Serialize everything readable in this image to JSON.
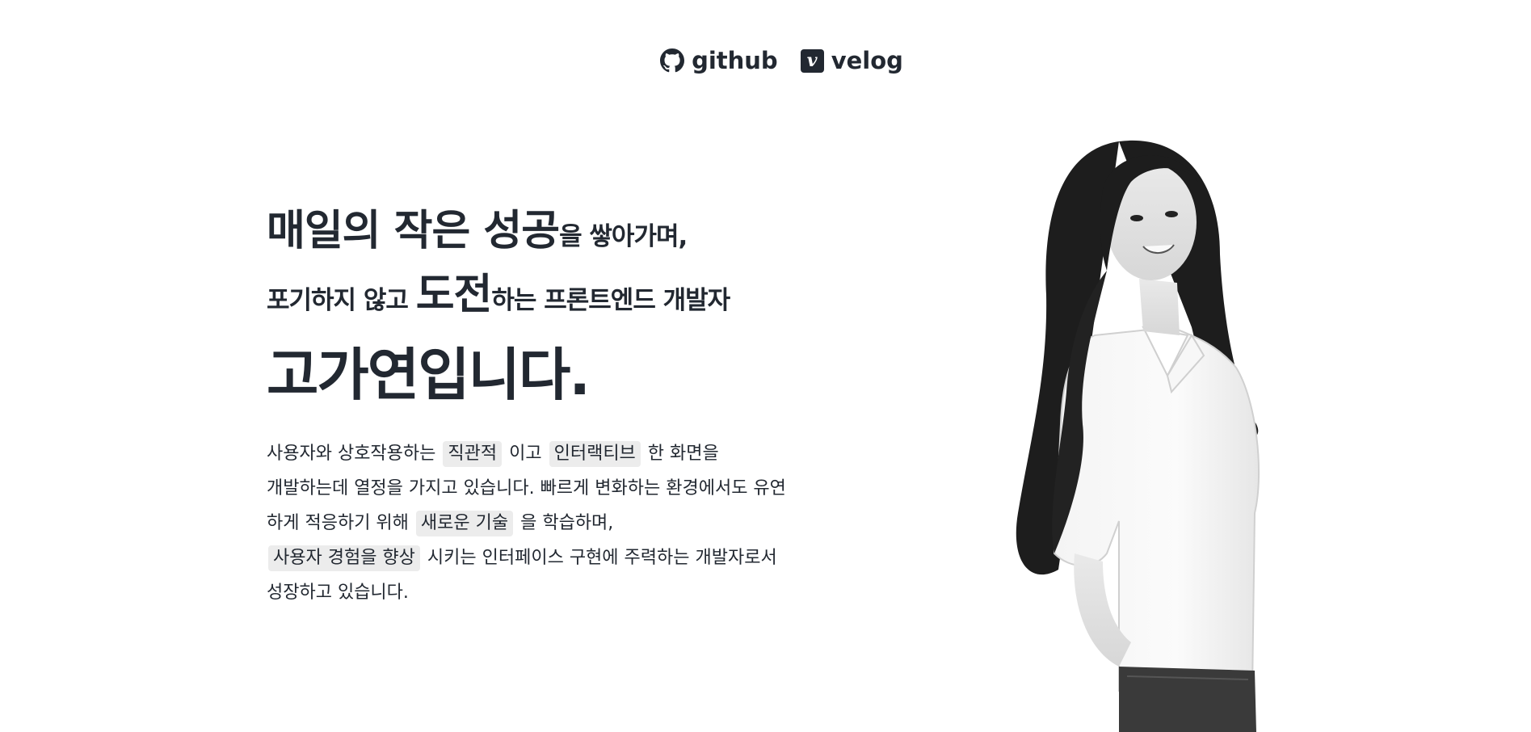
{
  "nav": {
    "github": {
      "label": "github",
      "icon": "github-icon"
    },
    "velog": {
      "label": "velog",
      "icon": "velog-icon",
      "icon_glyph": "v"
    }
  },
  "hero": {
    "line1": {
      "emphasis": "매일의 작은 성공",
      "rest": "을 쌓아가며,"
    },
    "line2": {
      "lead": "포기하지 않고 ",
      "emphasis": "도전",
      "rest": "하는 프론트엔드 개발자"
    },
    "line3": "고가연입니다."
  },
  "description": {
    "p1": {
      "a": "사용자와 상호작용하는 ",
      "chip1": "직관적",
      "b": " 이고 ",
      "chip2": "인터랙티브",
      "c": " 한 화면을"
    },
    "p2": "개발하는데 열정을 가지고 있습니다. 빠르게 변화하는 환경에서도 유연",
    "p3": {
      "a": "하게 적응하기 위해 ",
      "chip": "새로운 기술",
      "b": " 을 학습하며,"
    },
    "p4": {
      "chip": "사용자 경험을 향상",
      "b": " 시키는 인터페이스 구현에 주력하는 개발자로서"
    },
    "p5": "성장하고 있습니다."
  },
  "colors": {
    "text": "#222831",
    "chip_bg": "#ececec",
    "background": "#ffffff"
  }
}
